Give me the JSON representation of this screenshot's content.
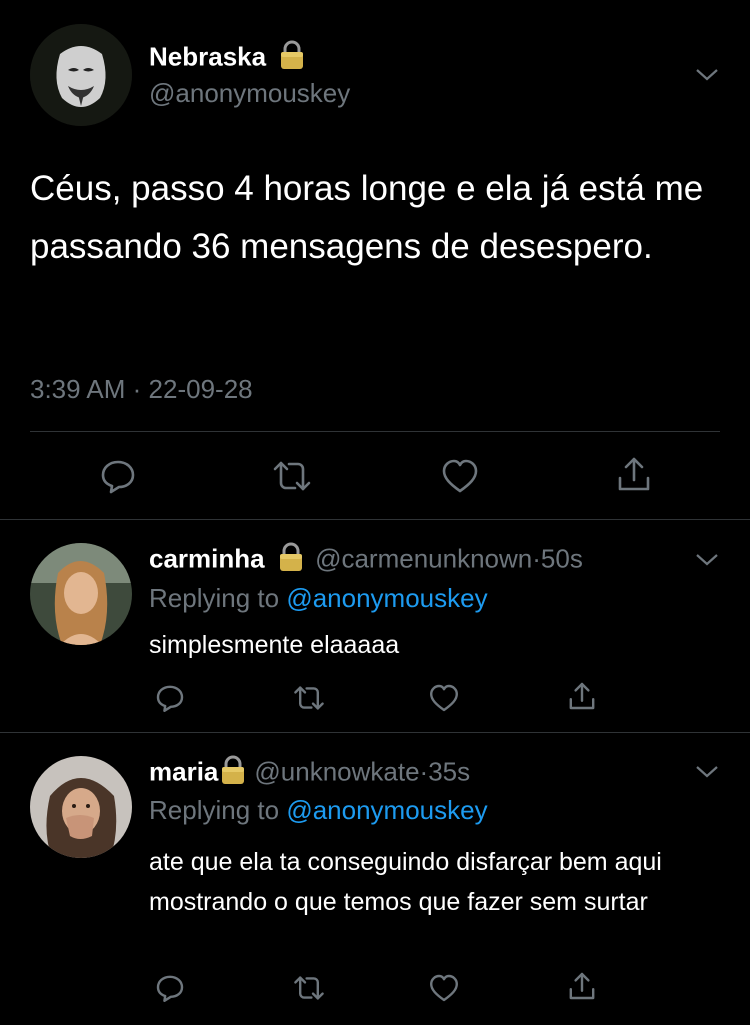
{
  "main_tweet": {
    "display_name": "Nebraska",
    "handle": "@anonymouskey",
    "text": "Céus, passo 4 horas longe e ela já está me passando 36 mensagens de desespero.",
    "time": "3:39 AM",
    "separator": "·",
    "date": "22-09-28"
  },
  "replies": [
    {
      "display_name": "carminha",
      "handle": "@carmenunknown",
      "age": "50s",
      "replying_prefix": "Replying to",
      "replying_handle": "@anonymouskey",
      "text": "simplesmente elaaaaa"
    },
    {
      "display_name": "maria",
      "handle": "@unknowkate",
      "age": "35s",
      "replying_prefix": "Replying to",
      "replying_handle": "@anonymouskey",
      "text": "ate que ela ta conseguindo disfarçar bem aqui mostrando o que temos que fazer sem surtar"
    }
  ],
  "icons": {
    "reply": "reply-icon",
    "retweet": "retweet-icon",
    "like": "heart-icon",
    "share": "share-icon",
    "menu": "chevron-down-icon",
    "protected": "lock-icon"
  },
  "colors": {
    "background": "#000000",
    "text": "#ffffff",
    "muted": "#6e767d",
    "link": "#1d9bf0",
    "lock": "#d4b24a"
  }
}
